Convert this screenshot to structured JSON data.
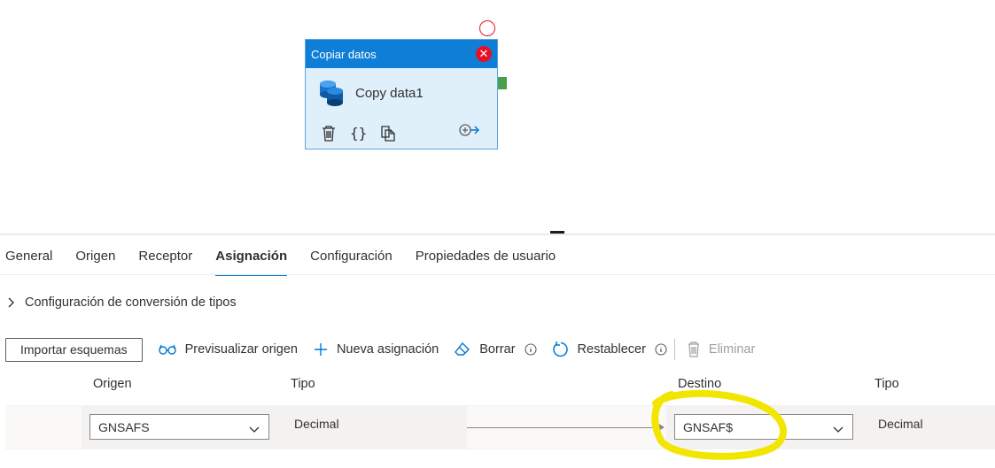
{
  "node": {
    "header_title": "Copiar datos",
    "name": "Copy data1",
    "close_glyph": "✕",
    "actions": [
      "trash-icon",
      "code-braces-icon",
      "copy-icon",
      "add-output-icon"
    ],
    "braces_glyph": "{}"
  },
  "tabs": [
    {
      "label": "General",
      "active": false
    },
    {
      "label": "Origen",
      "active": false
    },
    {
      "label": "Receptor",
      "active": false
    },
    {
      "label": "Asignación",
      "active": true
    },
    {
      "label": "Configuración",
      "active": false
    },
    {
      "label": "Propiedades de usuario",
      "active": false
    }
  ],
  "section": {
    "label": "Configuración de conversión de tipos"
  },
  "toolbar": {
    "import_label": "Importar esquemas",
    "preview_label": "Previsualizar origen",
    "new_mapping_label": "Nueva asignación",
    "clear_label": "Borrar",
    "reset_label": "Restablecer",
    "delete_label": "Eliminar"
  },
  "columns": {
    "source": "Origen",
    "source_type": "Tipo",
    "destination": "Destino",
    "destination_type": "Tipo"
  },
  "mapping_rows": [
    {
      "source": "GNSAFS",
      "source_type": "Decimal",
      "destination": "GNSAF$",
      "destination_type": "Decimal"
    }
  ],
  "colors": {
    "accent": "#0078d4",
    "node_header": "#0f7ed6",
    "node_body": "#dff0fb",
    "close_red": "#e81123",
    "success_port": "#4a9f4a",
    "highlight": "#f2e600"
  }
}
